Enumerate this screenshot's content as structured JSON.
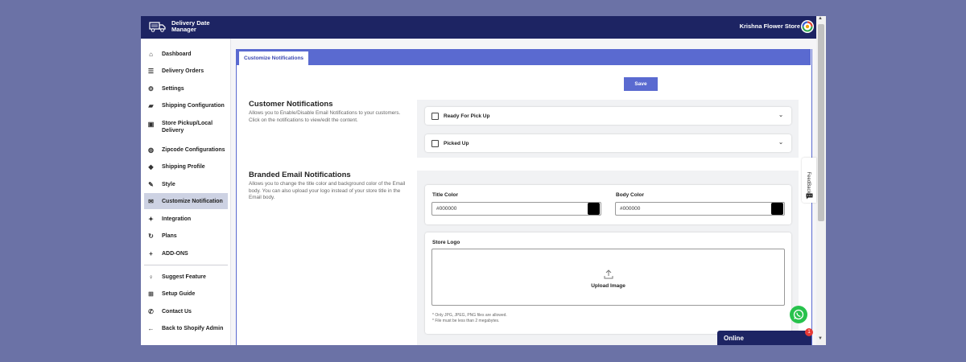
{
  "app": {
    "title_line1": "Delivery Date",
    "title_line2": "Manager",
    "store_name": "Krishna Flower Store"
  },
  "sidebar": {
    "items": [
      {
        "label": "Dashboard",
        "icon": "home-icon"
      },
      {
        "label": "Delivery Orders",
        "icon": "list-icon"
      },
      {
        "label": "Settings",
        "icon": "gear-icon"
      },
      {
        "label": "Shipping Configuration",
        "icon": "truck-icon"
      },
      {
        "label": "Store Pickup/Local",
        "label2": "Delivery",
        "icon": "store-icon"
      },
      {
        "label": "Zipcode Configurations",
        "icon": "globe-icon"
      },
      {
        "label": "Shipping Profile",
        "icon": "tag-icon"
      },
      {
        "label": "Style",
        "icon": "brush-icon"
      },
      {
        "label": "Customize Notification",
        "icon": "envelope-icon",
        "active": true
      },
      {
        "label": "Integration",
        "icon": "puzzle-icon"
      },
      {
        "label": "Plans",
        "icon": "refresh-icon"
      },
      {
        "label": "ADD-ONS",
        "icon": "plus-icon"
      },
      {
        "label": "Suggest Feature",
        "icon": "bulb-icon"
      },
      {
        "label": "Setup Guide",
        "icon": "guide-icon"
      },
      {
        "label": "Contact Us",
        "icon": "phone-icon"
      },
      {
        "label": "Back to Shopify Admin",
        "icon": "arrow-left-icon"
      }
    ]
  },
  "tabs": {
    "active": "Customize Notifications"
  },
  "toolbar": {
    "save_label": "Save"
  },
  "customer": {
    "title": "Customer Notifications",
    "desc": "Allows you to Enable/Disable Email Notifications to your customers. Click on the notifications to view/edit the content.",
    "items": [
      "Ready For Pick Up",
      "Picked Up"
    ]
  },
  "branded": {
    "title": "Branded Email Notifications",
    "desc": "Allows you to change the title color and background color of the Email body. You can also upload your logo instead of your store title in the Email body.",
    "title_color_label": "Title Color",
    "title_color_value": "#000000",
    "body_color_label": "Body Color",
    "body_color_value": "#000000",
    "swatch_color": "#000000",
    "store_logo_label": "Store Logo",
    "upload_label": "Upload Image",
    "hint1": "* Only JPG, JPEG, PNG files are allowed.",
    "hint2": "* File must be less than 2 megabytes."
  },
  "widgets": {
    "feedback_label": "FeedBack",
    "chat_label": "Online",
    "chat_badge": "1"
  },
  "colors": {
    "accent": "#5a6ad0",
    "topbar": "#1d2463",
    "whatsapp": "#27c24c"
  }
}
